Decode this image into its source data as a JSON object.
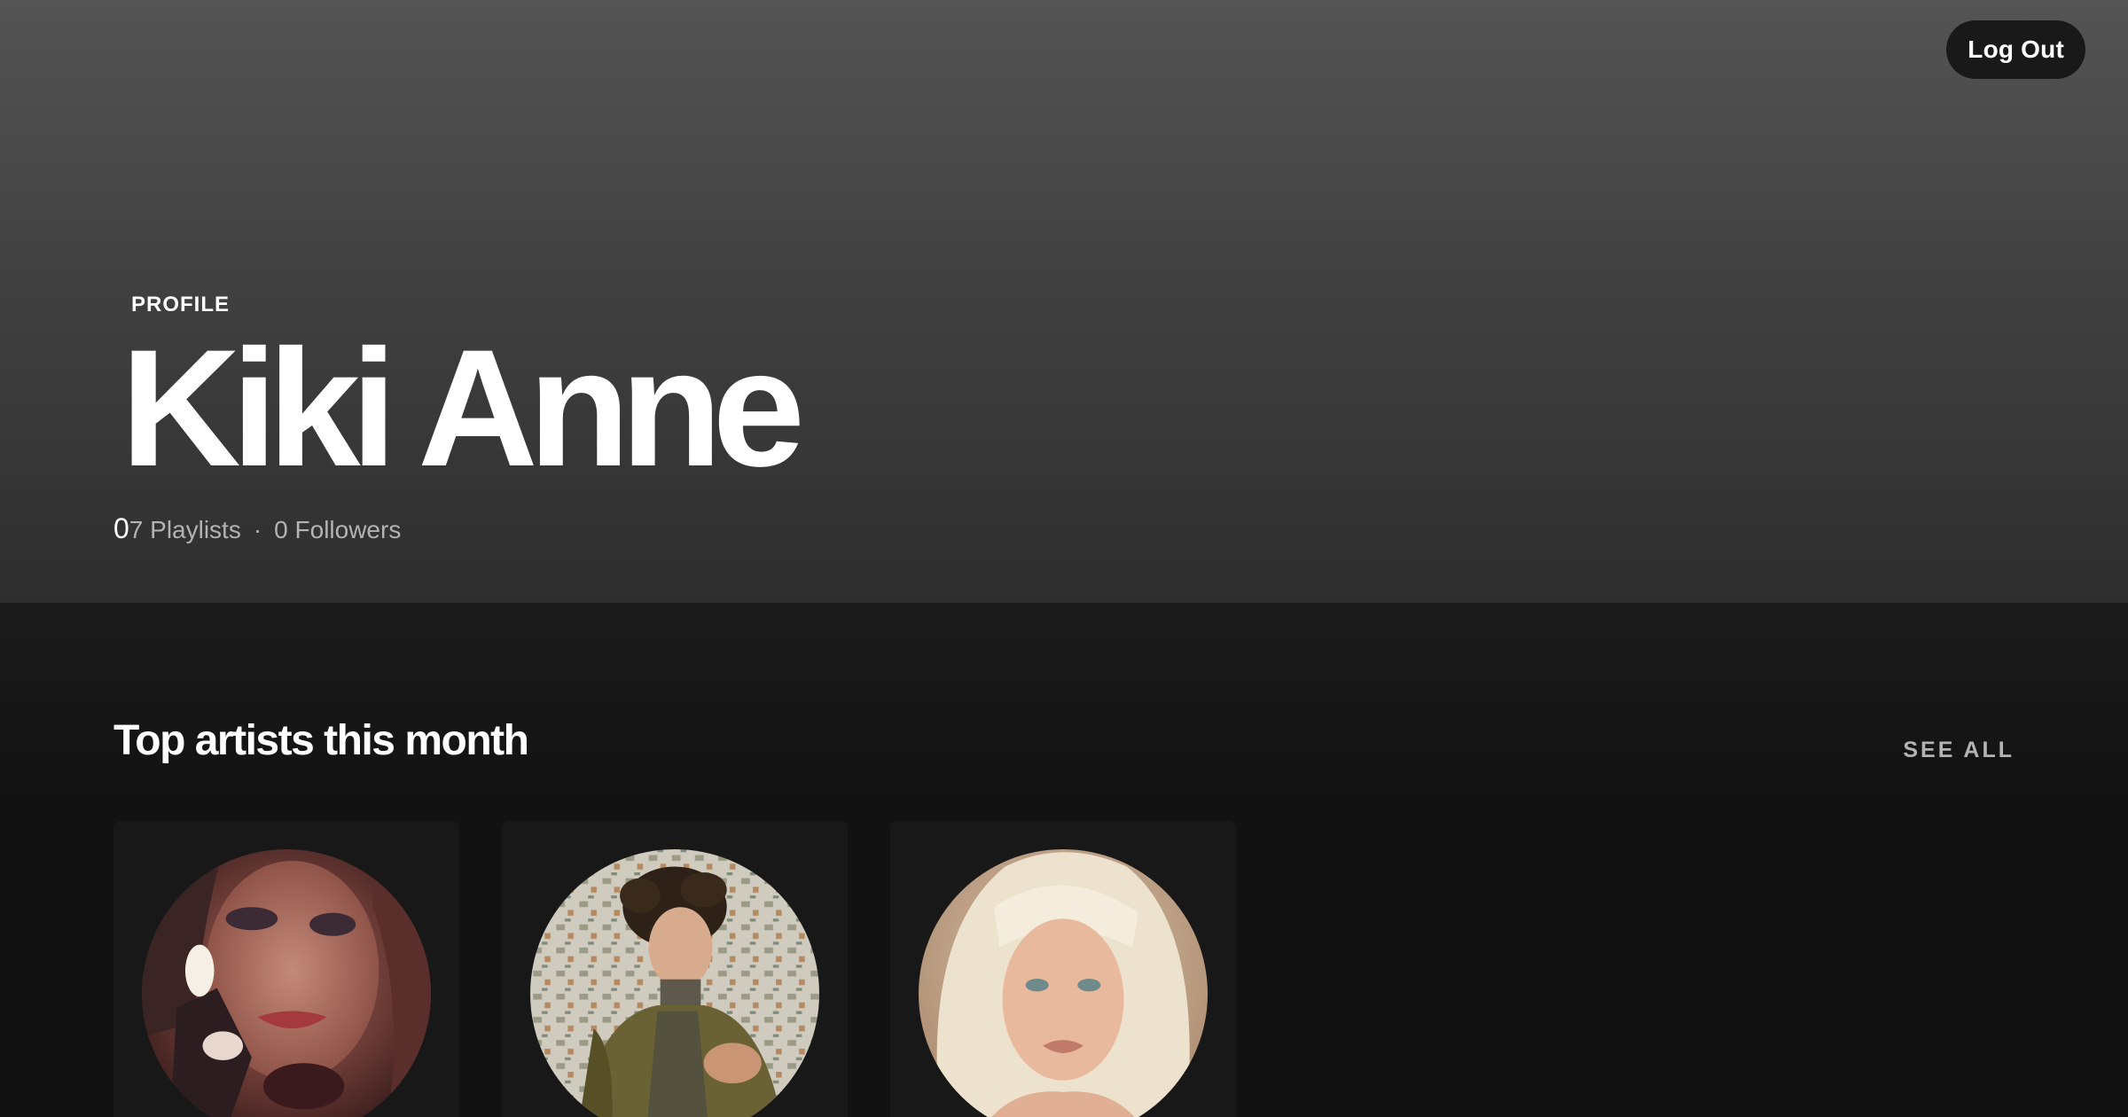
{
  "header": {
    "logout_label": "Log Out",
    "profile_label": "PROFILE",
    "user_name": "Kiki Anne",
    "stats": {
      "overlap_count": "0",
      "playlists": "7 Playlists",
      "separator": "·",
      "followers": "0 Followers"
    }
  },
  "top_artists": {
    "title": "Top artists this month",
    "see_all_label": "SEE ALL",
    "artists": [
      {
        "name": "",
        "image_icon": "artist-portrait-dark-hair-lighter"
      },
      {
        "name": "",
        "image_icon": "artist-portrait-curly-hair-jacket"
      },
      {
        "name": "",
        "image_icon": "artist-portrait-platinum-blonde"
      }
    ]
  },
  "colors": {
    "background": "#121212",
    "header_gradient_top": "#545454",
    "header_gradient_bottom": "#2e2e2e",
    "card": "#181818",
    "muted_text": "#b3b3b3",
    "button_bg": "#191919"
  }
}
